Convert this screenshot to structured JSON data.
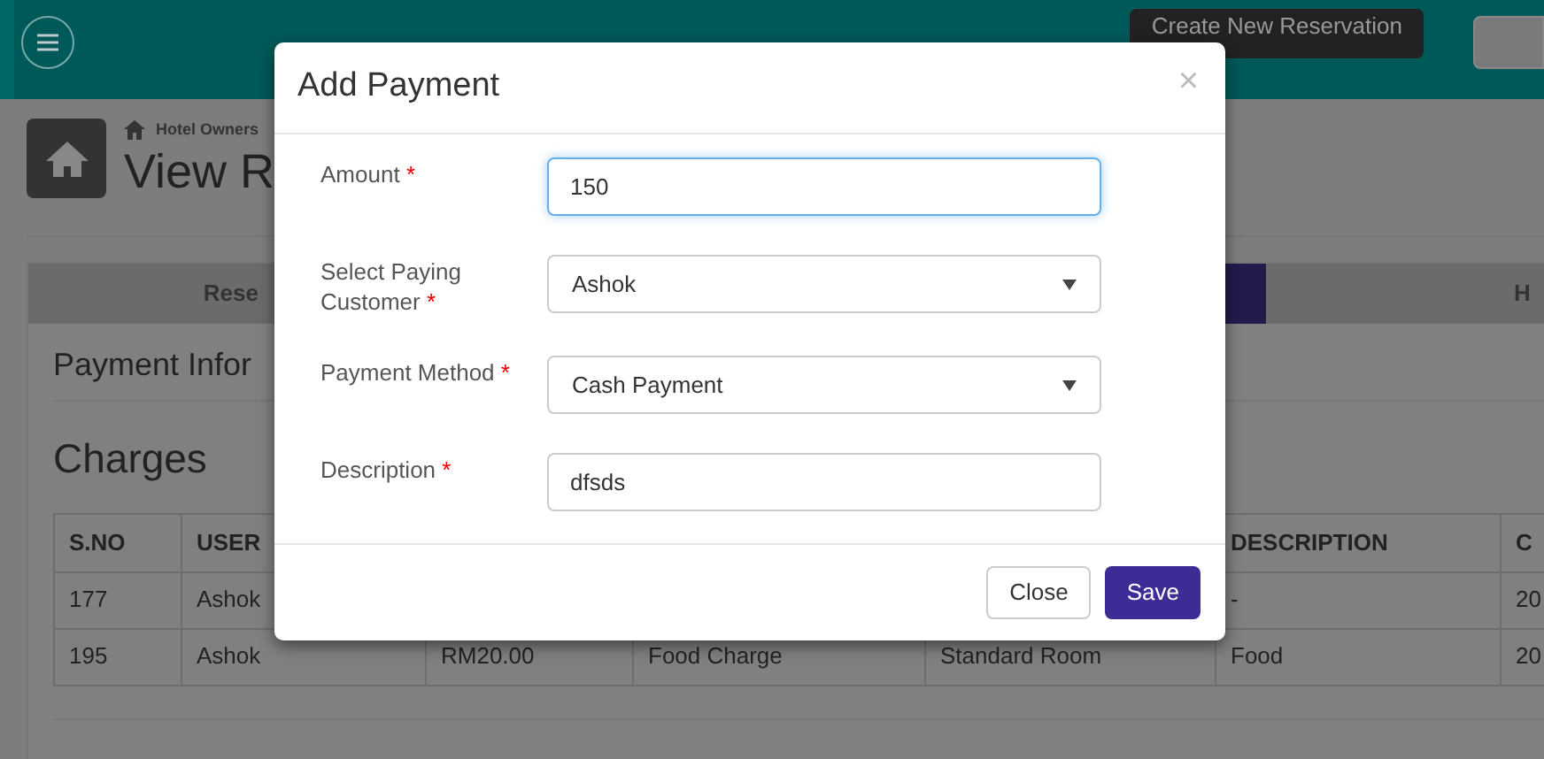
{
  "header": {
    "create_button": "Create New Reservation"
  },
  "page": {
    "breadcrumb": "Hotel Owners",
    "title": "View R"
  },
  "tabs": [
    {
      "label": "Rese",
      "selected": false
    },
    {
      "selected": true
    },
    {
      "label": "H",
      "selected": false
    }
  ],
  "section_title": "Payment Infor",
  "charges": {
    "title": "Charges",
    "columns": [
      "S.NO",
      "USER",
      null,
      null,
      null,
      "DESCRIPTION",
      "C"
    ],
    "rows": [
      [
        "177",
        "Ashok",
        null,
        null,
        null,
        "-",
        "20"
      ],
      [
        "195",
        "Ashok",
        "RM20.00",
        "Food Charge",
        "Standard Room",
        "Food",
        "20"
      ]
    ]
  },
  "modal": {
    "title": "Add Payment",
    "close": "×",
    "fields": [
      {
        "kind": "input",
        "label": "Amount",
        "required_mark": "*",
        "value": "150",
        "focused": true
      },
      {
        "kind": "select",
        "label": "Select Paying Customer",
        "required_mark": "*",
        "value": "Ashok",
        "focused": false
      },
      {
        "kind": "select",
        "label": "Payment Method",
        "required_mark": "*",
        "value": "Cash Payment",
        "focused": false
      },
      {
        "kind": "input",
        "label": "Description",
        "required_mark": "*",
        "value": "dfsds",
        "focused": false
      }
    ],
    "buttons": [
      {
        "label": "Close",
        "kind": "secondary"
      },
      {
        "label": "Save",
        "kind": "primary"
      }
    ]
  }
}
